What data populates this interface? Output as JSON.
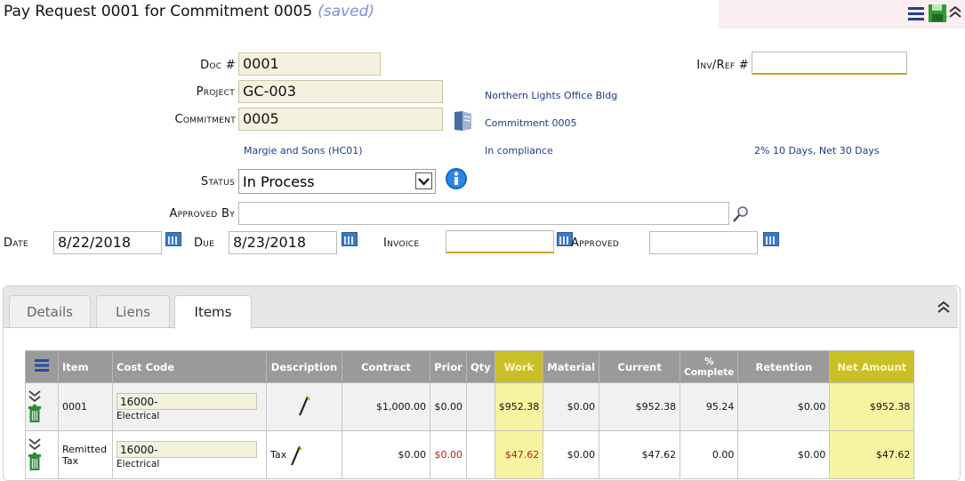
{
  "header": {
    "title": "Pay Request 0001 for Commitment 0005",
    "saved": "(saved)"
  },
  "form": {
    "doc_label": "Doc #",
    "doc_value": "0001",
    "invref_label": "Inv/Ref #",
    "invref_value": "",
    "project_label": "Project",
    "project_value": "GC-003",
    "project_name": "Northern Lights Office Bldg",
    "commitment_label": "Commitment",
    "commitment_value": "0005",
    "commitment_name": "Commitment 0005",
    "vendor": "Margie and Sons (HC01)",
    "compliance": "In compliance",
    "terms": "2% 10 Days, Net 30 Days",
    "status_label": "Status",
    "status_value": "In Process",
    "approved_by_label": "Approved By",
    "approved_by_value": "",
    "date_label": "Date",
    "date_value": "8/22/2018",
    "due_label": "Due",
    "due_value": "8/23/2018",
    "invoice_label": "Invoice",
    "invoice_value": "",
    "approved_label": "Approved",
    "approved_value": ""
  },
  "tabs": [
    {
      "label": "Details"
    },
    {
      "label": "Liens"
    },
    {
      "label": "Items"
    }
  ],
  "grid": {
    "columns": [
      "Item",
      "Cost Code",
      "Description",
      "Contract",
      "Prior",
      "Qty",
      "Work",
      "Material",
      "Current",
      "% Complete",
      "Retention",
      "Net Amount"
    ],
    "rows": [
      {
        "item": "0001",
        "cost_code": "16000-",
        "cost_desc": "Electrical",
        "description": "",
        "contract": "$1,000.00",
        "prior": "$0.00",
        "qty": "",
        "work": "$952.38",
        "material": "$0.00",
        "current": "$952.38",
        "pct": "95.24",
        "retention": "$0.00",
        "net": "$952.38"
      },
      {
        "item": "Remitted Tax",
        "cost_code": "16000-",
        "cost_desc": "Electrical",
        "description": "Tax",
        "contract": "$0.00",
        "prior": "$0.00",
        "qty": "",
        "work": "$47.62",
        "material": "$0.00",
        "current": "$47.62",
        "pct": "0.00",
        "retention": "$0.00",
        "net": "$47.62"
      }
    ]
  },
  "icons": [
    "menu-icon",
    "save-icon",
    "collapse-icon",
    "binder-icon",
    "info-icon",
    "search-icon",
    "calendar-icon",
    "expand-rows-icon",
    "trash-icon",
    "pencil-icon"
  ],
  "colors": {
    "highlight_column": "#f6f4a0",
    "header_highlight": "#c9c028",
    "link_blue": "#1f3a8a",
    "saved": "#7a8fd6"
  }
}
